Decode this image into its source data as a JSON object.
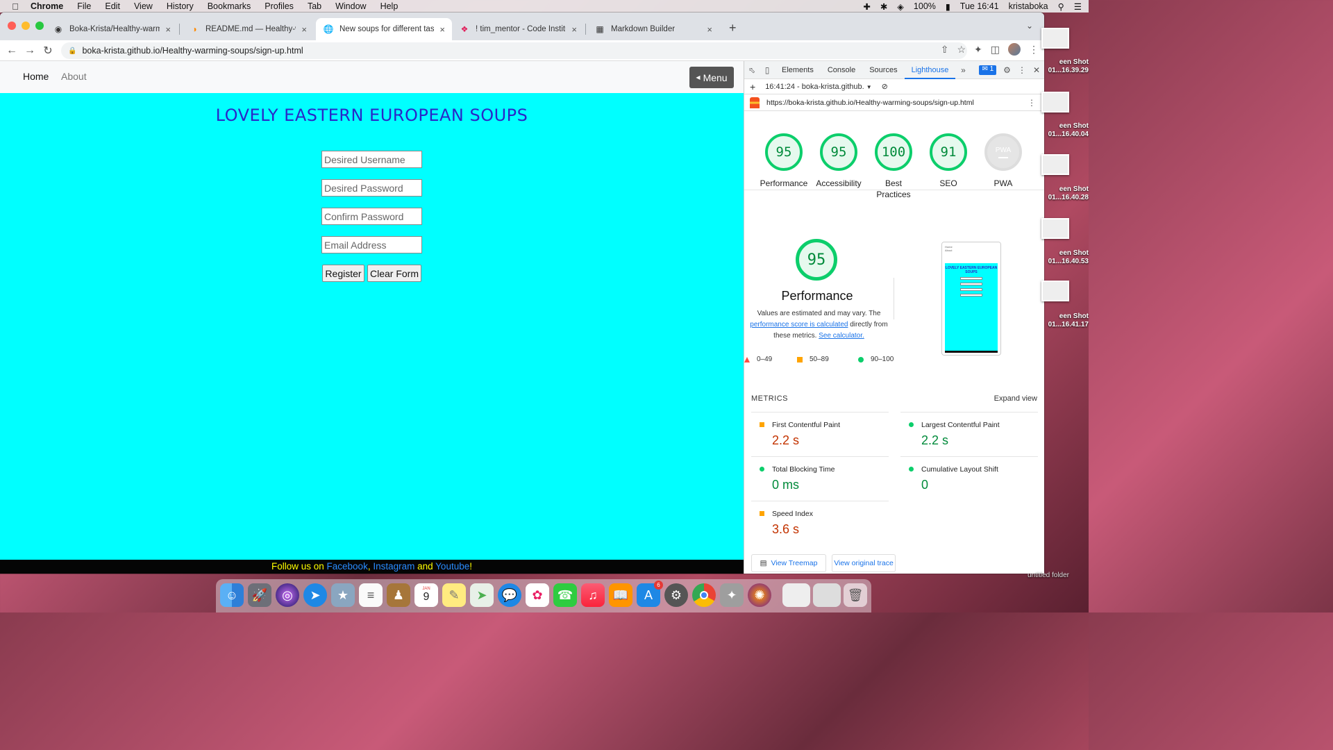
{
  "menubar": {
    "app": "Chrome",
    "items": [
      "File",
      "Edit",
      "View",
      "History",
      "Bookmarks",
      "Profiles",
      "Tab",
      "Window",
      "Help"
    ],
    "battery": "100%",
    "clock": "Tue 16:41",
    "user": "kristaboka"
  },
  "tabs": [
    {
      "title": "Boka-Krista/Healthy-warming-",
      "icon": "github-icon"
    },
    {
      "title": "README.md — Healthy-war",
      "icon": "gitpod-icon"
    },
    {
      "title": "New soups for different tastes",
      "icon": "globe-icon",
      "active": true
    },
    {
      "title": "! tim_mentor - Code Institute -",
      "icon": "slack-icon"
    },
    {
      "title": "Markdown Builder",
      "icon": "markdown-icon"
    }
  ],
  "address": {
    "url": "boka-krista.github.io/Healthy-warming-soups/sign-up.html"
  },
  "site": {
    "nav": {
      "home": "Home",
      "about": "About",
      "menu": "Menu"
    },
    "title": "LOVELY EASTERN EUROPEAN SOUPS",
    "form": {
      "username_placeholder": "Desired Username",
      "password_placeholder": "Desired Password",
      "confirm_placeholder": "Confirm Password",
      "email_placeholder": "Email Address",
      "register": "Register",
      "clear": "Clear Form"
    },
    "footer": {
      "prefix": "Follow us on ",
      "facebook": "Facebook",
      "sep1": ", ",
      "instagram": "Instagram",
      "sep2": " and ",
      "youtube": "Youtube",
      "suffix": "!"
    }
  },
  "devtools": {
    "tabs": [
      "Elements",
      "Console",
      "Sources",
      "Lighthouse"
    ],
    "active_tab": "Lighthouse",
    "messages_badge": "1",
    "report_select": "16:41:24 - boka-krista.github.",
    "report_url": "https://boka-krista.github.io/Healthy-warming-soups/sign-up.html",
    "scores": [
      {
        "label": "Performance",
        "value": "95"
      },
      {
        "label": "Accessibility",
        "value": "95"
      },
      {
        "label": "Best Practices",
        "value": "100"
      },
      {
        "label": "SEO",
        "value": "91"
      },
      {
        "label": "PWA",
        "value": "PWA"
      }
    ],
    "performance": {
      "score": "95",
      "title": "Performance",
      "desc_1": "Values are estimated and may vary. The",
      "desc_link": "performance score is calculated",
      "desc_2": " directly from these metrics. ",
      "desc_link2": "See calculator.",
      "legend": [
        "0–49",
        "50–89",
        "90–100"
      ]
    },
    "metrics_head": "METRICS",
    "expand_view": "Expand view",
    "metrics": [
      {
        "name": "First Contentful Paint",
        "value": "2.2 s",
        "status": "orange"
      },
      {
        "name": "Largest Contentful Paint",
        "value": "2.2 s",
        "status": "green"
      },
      {
        "name": "Total Blocking Time",
        "value": "0 ms",
        "status": "green"
      },
      {
        "name": "Cumulative Layout Shift",
        "value": "0",
        "status": "green"
      },
      {
        "name": "Speed Index",
        "value": "3.6 s",
        "status": "orange"
      }
    ],
    "buttons": {
      "treemap": "View Treemap",
      "trace": "View original trace"
    }
  },
  "thumbnail": {
    "nav_home": "Home",
    "nav_about": "About",
    "title": "LOVELY EASTERN EUROPEAN SOUPS"
  },
  "desktop": {
    "icons": [
      {
        "line1": "een Shot",
        "line2": "01...16.39.29"
      },
      {
        "line1": "een Shot",
        "line2": "01...16.40.04"
      },
      {
        "line1": "een Shot",
        "line2": "01...16.40.28"
      },
      {
        "line1": "een Shot",
        "line2": "01...16.40.53"
      },
      {
        "line1": "een Shot",
        "line2": "01...16.41.17"
      }
    ],
    "folder": "untitled folder"
  },
  "dock": {
    "calendar_month": "JAN",
    "calendar_day": "9",
    "appstore_badge": "6"
  }
}
